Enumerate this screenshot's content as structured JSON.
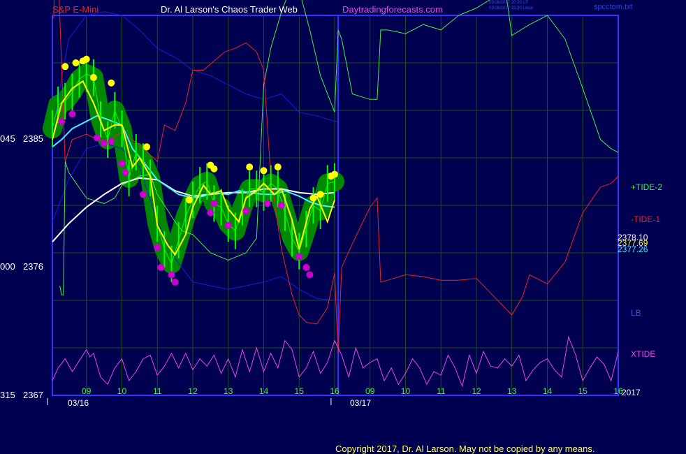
{
  "header": {
    "symbol": "S&P E-Mini",
    "site": "Dr. Al Larson's Chaos Trader Web",
    "url": "Daytradingforecasts.com",
    "timestamp_ut": "03/16/2017 20:20 UT",
    "timestamp_local": "03/16/2017 15:20 Local",
    "file": "spcctom.txt"
  },
  "colors": {
    "background": "#000050",
    "grid": "#1d4f1d",
    "frame": "#3333ff",
    "price_bar": "#00ff00",
    "highlight": "#008800",
    "swing_high": "#ffff00",
    "swing_low": "#cc00cc",
    "tide_plus": "#44ee44",
    "tide_minus": "#ee2222",
    "lb": "#1a1ae0",
    "xtide": "#ee44ee",
    "white_ma": "#ffffff",
    "cyan_ma": "#44eeff",
    "yellow_ma": "#ffff00"
  },
  "copyright": "Copyright 2017, Dr. Al Larson. May not be copied by any means.",
  "chart_data": {
    "type": "line",
    "title": "S&P E-Mini",
    "y_axis": {
      "labels": [
        {
          "left": "045",
          "right": "2385",
          "value": 2385
        },
        {
          "left": "000",
          "right": "2376",
          "value": 2376
        },
        {
          "left": "315",
          "right": "2367",
          "value": 2367
        }
      ],
      "range": [
        2367,
        2387.8
      ]
    },
    "x_axis": {
      "hour_ticks": [
        "09",
        "10",
        "11",
        "12",
        "13",
        "14",
        "15",
        "16",
        "09",
        "10",
        "11",
        "12",
        "13",
        "14",
        "15",
        "16"
      ],
      "hour_positions": [
        9,
        10,
        11,
        12,
        13,
        14,
        15,
        16,
        17,
        18,
        19,
        20,
        21,
        22,
        23,
        24
      ],
      "dates": [
        {
          "label": "03/16",
          "x": 8.6
        },
        {
          "label": "03/17",
          "x": 16.6
        }
      ],
      "year": "2017",
      "range": [
        8.04,
        24.0
      ],
      "divider_x": 16.1
    },
    "right_labels": [
      {
        "text": "+TIDE-2",
        "color": "#44ee44",
        "y": 2380.5
      },
      {
        "text": "-TIDE-1",
        "color": "#ee2222",
        "y": 2378.6
      },
      {
        "text": "2378.10",
        "color": "#ffffff",
        "y": 2377.8
      },
      {
        "text": "2377.69",
        "color": "#ffff00",
        "y": 2377.5
      },
      {
        "text": "2377.26",
        "color": "#44eeff",
        "y": 2377.2
      },
      {
        "text": "LB",
        "color": "#3355ff",
        "y": 2372.8
      },
      {
        "text": "XTIDE",
        "color": "#ee44ee",
        "y": 2369.7
      }
    ],
    "last_values": {
      "white": 2378.1,
      "yellow": 2377.69,
      "cyan": 2377.26
    },
    "series": [
      {
        "name": "+TIDE-2",
        "color": "#44ee44",
        "x": [
          8.25,
          8.3,
          8.35,
          8.4,
          8.5,
          9,
          9.5,
          9.8,
          10,
          10.5,
          10.8,
          11,
          11.5,
          11.7,
          12,
          12.5,
          13,
          13.5,
          13.8,
          14,
          14.2,
          14.5,
          14.8,
          15,
          15.3,
          15.6,
          16,
          16.1,
          16.2,
          16.5,
          17,
          17.2,
          17.3,
          17.5,
          18,
          18.5,
          19,
          19.5,
          20,
          20.5,
          20.7,
          20.8,
          21,
          21.5,
          22,
          22.5,
          23,
          23.5,
          23.8,
          24
        ],
        "y": [
          2373,
          2372.5,
          2372.5,
          2379.8,
          2379.2,
          2377.8,
          2377.5,
          2377.8,
          2378.5,
          2379.0,
          2379.1,
          2378.0,
          2376.5,
          2376.0,
          2375.8,
          2374.8,
          2374.4,
          2374.8,
          2375.6,
          2384.0,
          2386.0,
          2388.0,
          2389.5,
          2389.2,
          2387.0,
          2384.5,
          2382.5,
          2387.0,
          2386.5,
          2383.5,
          2383.2,
          2383.2,
          2387.0,
          2387.0,
          2386.8,
          2387.3,
          2387.0,
          2387.8,
          2388.2,
          2388.8,
          2389.8,
          2389.5,
          2386.7,
          2387.3,
          2387.8,
          2386.5,
          2383.8,
          2381.0,
          2380.5,
          2380.3
        ]
      },
      {
        "name": "-TIDE-1",
        "color": "#ee2222",
        "x": [
          8.04,
          8.08,
          8.12,
          8.2,
          8.3,
          8.4,
          8.6,
          9,
          9.3,
          9.6,
          10,
          10.5,
          11,
          11.2,
          11.5,
          11.8,
          12,
          12.3,
          12.6,
          12.9,
          13.2,
          13.5,
          13.8,
          14,
          14.2,
          14.5,
          14.8,
          15,
          15.2,
          15.5,
          15.8,
          16,
          16.1,
          16.2,
          16.5,
          17,
          17.2,
          17.3,
          17.5,
          18,
          18.5,
          19,
          19.5,
          20,
          20.5,
          21,
          21.3,
          21.5,
          22,
          22.5,
          23,
          23.5,
          23.8,
          24
        ],
        "y": [
          2387.6,
          2387.7,
          2392.0,
          2390.5,
          2385.0,
          2379.8,
          2381.0,
          2381.3,
          2381.0,
          2380.9,
          2381.4,
          2380.7,
          2379.8,
          2381.8,
          2381.5,
          2383.0,
          2384.8,
          2384.8,
          2385.3,
          2385.8,
          2386.0,
          2386.3,
          2385.8,
          2384.8,
          2379.0,
          2375.0,
          2372.5,
          2371.4,
          2371.0,
          2370.9,
          2371.8,
          2373.7,
          2369.3,
          2374.0,
          2375.3,
          2377.3,
          2377.8,
          2373.2,
          2373.3,
          2373.6,
          2373.5,
          2373.3,
          2373.3,
          2373.4,
          2372.4,
          2371.4,
          2372.4,
          2373.6,
          2373.1,
          2374.3,
          2377.0,
          2378.4,
          2378.6,
          2379.0
        ]
      },
      {
        "name": "LB",
        "color": "#1a1ae0",
        "x": [
          8.04,
          8.5,
          9,
          9.5,
          10,
          10.5,
          11,
          11.5,
          12,
          12.5,
          13,
          13.5,
          14,
          14.5,
          15,
          15.5,
          16,
          16.1
        ],
        "y": [
          2381.4,
          2386.5,
          2387.8,
          2388.0,
          2387.8,
          2387.0,
          2386.0,
          2385.5,
          2384.8,
          2384.5,
          2384.0,
          2383.5,
          2383.2,
          2383.5,
          2382.5,
          2382.3,
          2382.0,
          2382.0
        ]
      },
      {
        "name": "LB-lower",
        "color": "#1a1ae0",
        "x": [
          8.04,
          8.5,
          9,
          9.5,
          10,
          10.5,
          11,
          11.5,
          12,
          12.5,
          13,
          13.5,
          14,
          14.5,
          15,
          15.5,
          16,
          16.1
        ],
        "y": [
          2376.5,
          2378.8,
          2380.5,
          2380.8,
          2380.5,
          2379.5,
          2376.5,
          2374.5,
          2373.2,
          2373.0,
          2372.8,
          2373.0,
          2373.2,
          2373.5,
          2372.8,
          2372.3,
          2372.2,
          2372.3
        ]
      },
      {
        "name": "white",
        "color": "#ffffff",
        "x": [
          8.04,
          8.5,
          9,
          9.5,
          10,
          10.5,
          11,
          11.5,
          12,
          12.5,
          13,
          13.5,
          14,
          14.5,
          15,
          15.5,
          16
        ],
        "y": [
          2375.4,
          2376.4,
          2377.3,
          2378.0,
          2378.6,
          2378.9,
          2378.8,
          2378.2,
          2377.9,
          2378.0,
          2378.1,
          2378.1,
          2378.3,
          2378.3,
          2378.1,
          2378.0,
          2378.1
        ]
      },
      {
        "name": "cyan",
        "color": "#44eeff",
        "x": [
          8.04,
          8.3,
          8.6,
          9,
          9.3,
          9.6,
          10,
          10.3,
          10.6,
          11,
          11.3,
          11.6,
          12,
          12.3,
          12.6,
          13,
          13.3,
          13.6,
          14,
          14.3,
          14.6,
          15,
          15.3,
          15.6,
          16
        ],
        "y": [
          2380.6,
          2381.0,
          2381.6,
          2382.0,
          2382.3,
          2382.1,
          2381.8,
          2380.5,
          2379.8,
          2378.8,
          2378.4,
          2378.0,
          2377.8,
          2377.9,
          2378.1,
          2378.0,
          2378.2,
          2378.1,
          2378.0,
          2378.0,
          2378.2,
          2377.9,
          2377.6,
          2377.4,
          2377.3
        ]
      },
      {
        "name": "XTIDE",
        "color": "#ee44ee",
        "x": [
          8.04,
          8.2,
          8.4,
          8.6,
          8.8,
          9,
          9.1,
          9.2,
          9.4,
          9.6,
          9.8,
          10,
          10.2,
          10.4,
          10.6,
          10.8,
          11,
          11.2,
          11.4,
          11.6,
          11.8,
          12,
          12.2,
          12.4,
          12.6,
          12.8,
          13,
          13.2,
          13.4,
          13.6,
          13.8,
          14,
          14.2,
          14.4,
          14.6,
          14.8,
          15,
          15.2,
          15.4,
          15.6,
          15.8,
          16,
          16.2,
          16.4,
          16.6,
          16.8,
          17,
          17.2,
          17.4,
          17.6,
          17.8,
          18,
          18.2,
          18.4,
          18.6,
          18.8,
          19,
          19.2,
          19.4,
          19.6,
          19.8,
          20,
          20.2,
          20.4,
          20.6,
          20.8,
          21,
          21.2,
          21.4,
          21.6,
          21.8,
          22,
          22.2,
          22.4,
          22.6,
          22.8,
          23,
          23.2,
          23.4,
          23.6,
          23.8,
          24
        ],
        "y": [
          2367.8,
          2368.5,
          2369.0,
          2368.3,
          2368.9,
          2369.5,
          2369.1,
          2369.3,
          2368.0,
          2367.6,
          2368.5,
          2369.0,
          2367.8,
          2368.3,
          2369.0,
          2369.2,
          2368.1,
          2368.6,
          2369.3,
          2368.5,
          2369.3,
          2368.4,
          2369.0,
          2368.6,
          2369.2,
          2368.2,
          2369.0,
          2368.0,
          2369.5,
          2368.3,
          2369.6,
          2368.3,
          2369.3,
          2368.5,
          2370.0,
          2369.5,
          2368.0,
          2368.5,
          2369.4,
          2368.2,
          2368.8,
          2370.0,
          2369.2,
          2368.0,
          2369.6,
          2368.5,
          2368.8,
          2369.0,
          2367.8,
          2368.5,
          2367.6,
          2368.2,
          2369.0,
          2368.5,
          2367.6,
          2368.3,
          2368.1,
          2369.2,
          2368.5,
          2367.5,
          2369.2,
          2368.2,
          2369.4,
          2368.6,
          2368.5,
          2369.0,
          2368.6,
          2369.2,
          2367.8,
          2368.4,
          2368.8,
          2369.0,
          2368.4,
          2368.0,
          2370.2,
          2369.2,
          2367.8,
          2368.5,
          2369.1,
          2368.7,
          2367.8,
          2369.4
        ]
      },
      {
        "name": "yellow",
        "color": "#ffff00",
        "x": [
          8.04,
          8.3,
          8.6,
          8.9,
          9.2,
          9.5,
          9.8,
          10.0,
          10.3,
          10.5,
          10.8,
          11.0,
          11.3,
          11.5,
          11.8,
          12.0,
          12.3,
          12.5,
          12.8,
          13.0,
          13.3,
          13.5,
          13.8,
          14.0,
          14.3,
          14.5,
          14.8,
          15.0,
          15.3,
          15.5,
          15.8,
          16.0
        ],
        "y": [
          2381.0,
          2383.0,
          2383.8,
          2384.2,
          2383.0,
          2381.5,
          2381.8,
          2381.8,
          2379.5,
          2380.0,
          2379.0,
          2376.3,
          2375.2,
          2374.7,
          2375.8,
          2377.3,
          2378.5,
          2378.0,
          2378.2,
          2377.2,
          2376.5,
          2377.8,
          2378.2,
          2378.6,
          2378.0,
          2378.3,
          2376.6,
          2375.0,
          2377.2,
          2377.9,
          2376.5,
          2377.7
        ]
      },
      {
        "name": "price",
        "color": "#00ff00",
        "x": [
          8.04,
          8.2,
          8.4,
          8.6,
          8.8,
          9.0,
          9.2,
          9.4,
          9.6,
          9.8,
          10.0,
          10.2,
          10.4,
          10.6,
          10.8,
          11.0,
          11.2,
          11.4,
          11.6,
          11.8,
          12.0,
          12.2,
          12.4,
          12.6,
          12.8,
          13.0,
          13.2,
          13.4,
          13.6,
          13.8,
          14.0,
          14.2,
          14.4,
          14.6,
          14.8,
          15.0,
          15.2,
          15.4,
          15.6,
          15.8,
          16.0
        ],
        "y": [
          2381.6,
          2382.9,
          2383.1,
          2383.6,
          2384.3,
          2384.6,
          2384.4,
          2382.1,
          2381.0,
          2382.6,
          2381.6,
          2378.9,
          2380.3,
          2379.8,
          2378.9,
          2376.4,
          2375.0,
          2374.2,
          2375.5,
          2376.8,
          2377.7,
          2378.5,
          2378.7,
          2377.5,
          2377.3,
          2376.4,
          2376.0,
          2377.3,
          2378.3,
          2378.3,
          2378.1,
          2378.6,
          2378.3,
          2377.0,
          2375.6,
          2374.9,
          2376.1,
          2377.4,
          2377.1,
          2378.6,
          2378.7
        ]
      },
      {
        "name": "swing-highs",
        "color": "#ffff00",
        "x": [
          8.4,
          8.7,
          8.9,
          9.0,
          9.2,
          9.7,
          10.7,
          11.9,
          12.5,
          12.6,
          13.6,
          14.0,
          14.4,
          15.4,
          15.6,
          15.9,
          16.0
        ],
        "y": [
          2385.0,
          2385.2,
          2385.3,
          2385.4,
          2384.4,
          2384.1,
          2380.6,
          2377.7,
          2379.6,
          2379.4,
          2379.5,
          2379.3,
          2379.5,
          2377.8,
          2378.0,
          2379.0,
          2379.1
        ]
      },
      {
        "name": "swing-lows",
        "color": "#cc00cc",
        "x": [
          8.3,
          8.6,
          9.3,
          9.5,
          9.7,
          10.0,
          10.1,
          10.6,
          11.0,
          11.1,
          11.4,
          11.5,
          12.5,
          12.6,
          13.0,
          13.5,
          14.1,
          14.5,
          15.0,
          15.2,
          15.3
        ],
        "y": [
          2382.0,
          2382.4,
          2381.1,
          2380.8,
          2380.9,
          2379.7,
          2379.2,
          2378.0,
          2375.1,
          2374.0,
          2373.6,
          2373.2,
          2377.0,
          2377.5,
          2376.3,
          2377.1,
          2377.5,
          2377.4,
          2374.6,
          2374.0,
          2373.6
        ]
      }
    ]
  }
}
